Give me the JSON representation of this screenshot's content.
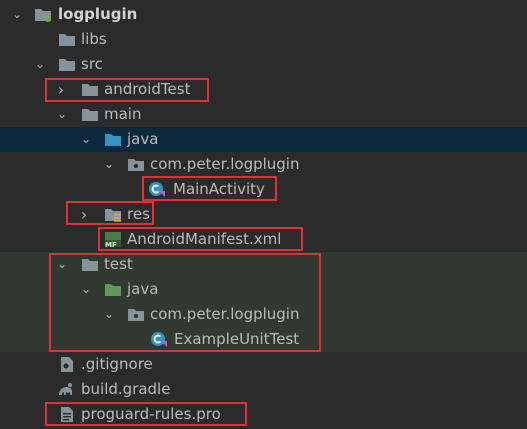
{
  "tree": {
    "root": "logplugin",
    "libs": "libs",
    "src": "src",
    "androidTest": "androidTest",
    "main": "main",
    "main_java": "java",
    "main_package": "com.peter.logplugin",
    "main_activity": "MainActivity",
    "res": "res",
    "manifest": "AndroidManifest.xml",
    "manifest_badge": "MF",
    "test": "test",
    "test_java": "java",
    "test_package": "com.peter.logplugin",
    "unit_test": "ExampleUnitTest",
    "gitignore": ".gitignore",
    "build_gradle": "build.gradle",
    "proguard": "proguard-rules.pro"
  },
  "colors": {
    "background": "#2b2b2b",
    "selected_row": "#0d293e",
    "test_rows": "#313a31",
    "folder": "#87939a",
    "source_folder": "#3592c4",
    "test_folder": "#629755",
    "highlight_box": "#e0303a"
  },
  "icons": {
    "chevron_down": "⌄",
    "chevron_right": "›"
  }
}
